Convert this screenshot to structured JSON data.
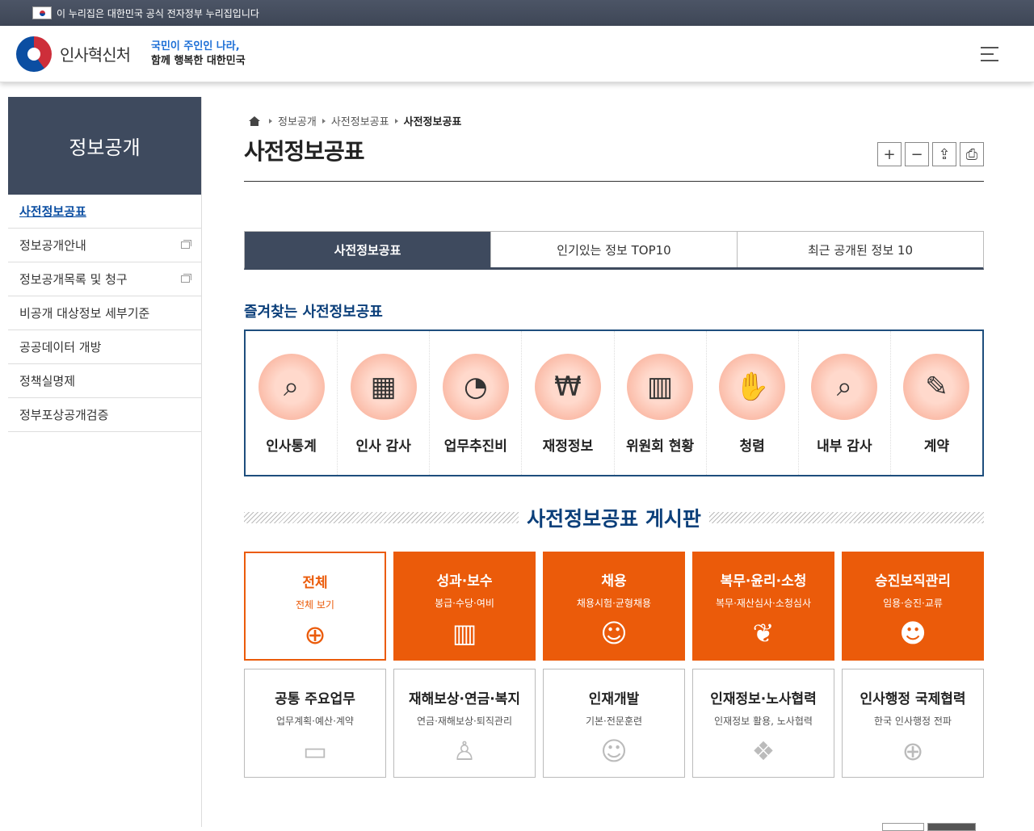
{
  "gov": {
    "notice": "이 누리집은 대한민국 공식 전자정부 누리집입니다"
  },
  "header": {
    "org": "인사혁신처",
    "slogan_line1": "국민이 주인인 나라,",
    "slogan_line2": "함께 행복한 대한민국"
  },
  "sidebar": {
    "title": "정보공개",
    "items": [
      {
        "label": "사전정보공표"
      },
      {
        "label": "정보공개안내"
      },
      {
        "label": "정보공개목록 및 청구"
      },
      {
        "label": "비공개 대상정보 세부기준"
      },
      {
        "label": "공공데이터 개방"
      },
      {
        "label": "정책실명제"
      },
      {
        "label": "정부포상공개검증"
      }
    ]
  },
  "breadcrumb": [
    "정보공개",
    "사전정보공표",
    "사전정보공표"
  ],
  "page": {
    "title": "사전정보공표"
  },
  "tools": {
    "zoom_in": "+",
    "zoom_out": "−",
    "share": "⇪",
    "print": "⎙"
  },
  "tabs": [
    "사전정보공표",
    "인기있는 정보 TOP10",
    "최근 공개된 정보 10"
  ],
  "favorites": {
    "title": "즐겨찾는 사전정보공표",
    "items": [
      {
        "label": "인사통계",
        "icon": "⌕"
      },
      {
        "label": "인사 감사",
        "icon": "▦"
      },
      {
        "label": "업무추진비",
        "icon": "◔"
      },
      {
        "label": "재정정보",
        "icon": "₩"
      },
      {
        "label": "위원회 현황",
        "icon": "▥"
      },
      {
        "label": "청렴",
        "icon": "✋"
      },
      {
        "label": "내부 감사",
        "icon": "⌕"
      },
      {
        "label": "계약",
        "icon": "✎"
      }
    ]
  },
  "board": {
    "title": "사전정보공표 게시판",
    "categories": [
      {
        "name": "전체",
        "sub": "전체 보기",
        "icon": "⊕"
      },
      {
        "name": "성과·보수",
        "sub": "봉급·수당·여비",
        "icon": "▥"
      },
      {
        "name": "채용",
        "sub": "채용시험·균형채용",
        "icon": "☺"
      },
      {
        "name": "복무·윤리·소청",
        "sub": "복무·재산심사·소청심사",
        "icon": "❦"
      },
      {
        "name": "승진보직관리",
        "sub": "임용·승진·교류",
        "icon": "☻"
      },
      {
        "name": "공통 주요업무",
        "sub": "업무계획·예산·계약",
        "icon": "▭"
      },
      {
        "name": "재해보상·연금·복지",
        "sub": "연금·재해보상·퇴직관리",
        "icon": "♙"
      },
      {
        "name": "인재개발",
        "sub": "기본·전문훈련",
        "icon": "☺"
      },
      {
        "name": "인재정보·노사협력",
        "sub": "인재정보 활용, 노사협력",
        "icon": "❖"
      },
      {
        "name": "인사행정 국제협력",
        "sub": "한국 인사행정 전파",
        "icon": "⊕"
      }
    ]
  }
}
